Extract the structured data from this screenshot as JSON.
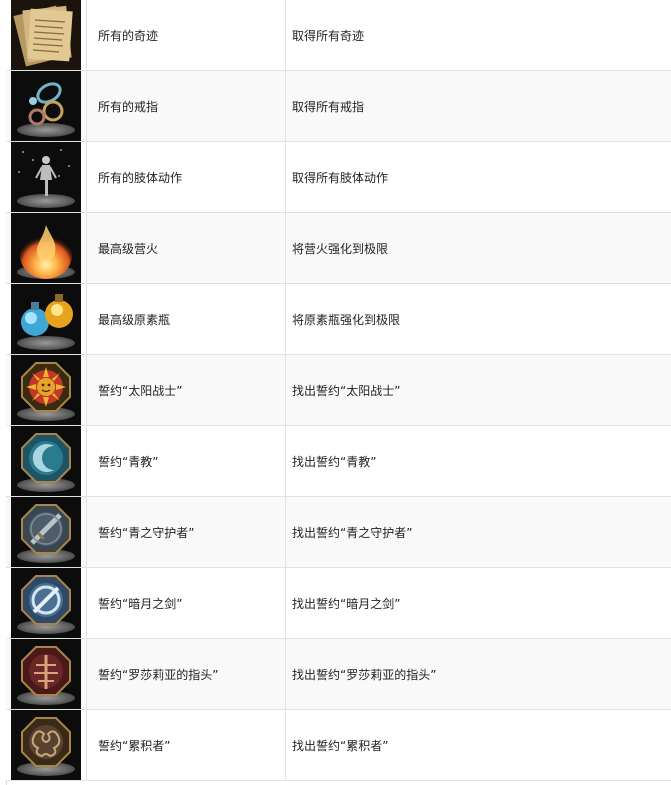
{
  "rows": [
    {
      "name": "所有的奇迹",
      "desc": "取得所有奇迹",
      "icon": "miracle-scrolls-icon"
    },
    {
      "name": "所有的戒指",
      "desc": "取得所有戒指",
      "icon": "rings-icon"
    },
    {
      "name": "所有的肢体动作",
      "desc": "取得所有肢体动作",
      "icon": "gesture-figure-icon"
    },
    {
      "name": "最高级营火",
      "desc": "将营火强化到极限",
      "icon": "bonfire-icon"
    },
    {
      "name": "最高级原素瓶",
      "desc": "将原素瓶强化到极限",
      "icon": "estus-flasks-icon"
    },
    {
      "name": "誓约“太阳战士”",
      "desc": "找出誓约“太阳战士”",
      "icon": "sun-covenant-icon"
    },
    {
      "name": "誓约“青教”",
      "desc": "找出誓约“青教”",
      "icon": "way-of-blue-icon"
    },
    {
      "name": "誓约“青之守护者”",
      "desc": "找出誓约“青之守护者”",
      "icon": "blue-sentinels-icon"
    },
    {
      "name": "誓约“暗月之剑”",
      "desc": "找出誓约“暗月之剑”",
      "icon": "blade-of-darkmoon-icon"
    },
    {
      "name": "誓约“罗莎莉亚的指头”",
      "desc": "找出誓约“罗莎莉亚的指头”",
      "icon": "rosarias-fingers-icon"
    },
    {
      "name": "誓约“累积者”",
      "desc": "找出誓约“累积者”",
      "icon": "mound-makers-icon"
    }
  ]
}
